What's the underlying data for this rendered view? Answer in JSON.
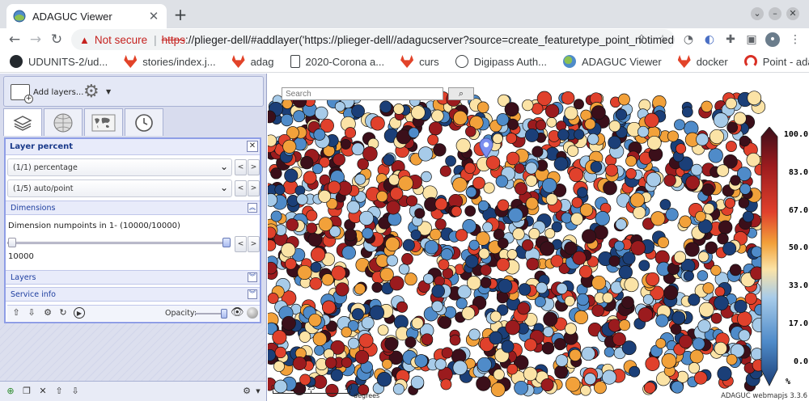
{
  "browser": {
    "tab_title": "ADAGUC Viewer",
    "new_tab_symbol": "+",
    "address": {
      "warning_label": "Not secure",
      "scheme": "https",
      "rest": "://plieger-dell/#addlayer('https://plieger-dell//adagucserver?source=create_featuretype_point_notimedi..."
    },
    "bookmarks": [
      {
        "label": "UDUNITS-2/ud...",
        "icon": "github-icon"
      },
      {
        "label": "stories/index.j...",
        "icon": "gitlab-icon"
      },
      {
        "label": "adag",
        "icon": "gitlab-icon"
      },
      {
        "label": "2020-Corona a...",
        "icon": "document-icon"
      },
      {
        "label": "curs",
        "icon": "gitlab-icon"
      },
      {
        "label": "Digipass Auth...",
        "icon": "globe-icon"
      },
      {
        "label": "ADAGUC Viewer",
        "icon": "adaguc-icon"
      },
      {
        "label": "docker",
        "icon": "gitlab-icon"
      },
      {
        "label": "Point - adaguc...",
        "icon": "point-icon"
      }
    ]
  },
  "panel": {
    "add_layers_label": "Add layers...",
    "layer_title": "Layer percent",
    "style_select": "(1/1) percentage",
    "render_select": "(1/5) auto/point",
    "dimensions_label": "Dimensions",
    "dimension_label": "Dimension numpoints in 1- (10000/10000)",
    "dimension_value": "10000",
    "dimension_slider_fraction": 1.0,
    "layers_label": "Layers",
    "service_info_label": "Service info",
    "opacity_label": "Opacity:",
    "opacity_fraction": 1.0
  },
  "map": {
    "search_placeholder": "Search",
    "legend": {
      "labels": [
        "100.0",
        "83.0",
        "67.0",
        "50.0",
        "33.0",
        "17.0",
        "0.0"
      ],
      "unit": "%",
      "colors": [
        "#3b0f1a",
        "#9b1b1e",
        "#e0412c",
        "#f2a13a",
        "#fbe3a6",
        "#a7cbe9",
        "#4f8bc9",
        "#1b3f78"
      ]
    },
    "scale": {
      "labels": [
        "0",
        "25",
        "50"
      ],
      "unit": "degrees"
    },
    "credits": "ADAGUC webmapjs 3.3.6",
    "marker_icon": "location-marker-icon"
  },
  "colors": {
    "accent": "#8f9ee6",
    "panel_bg": "#d8dcee",
    "insecure": "#c5221f"
  }
}
